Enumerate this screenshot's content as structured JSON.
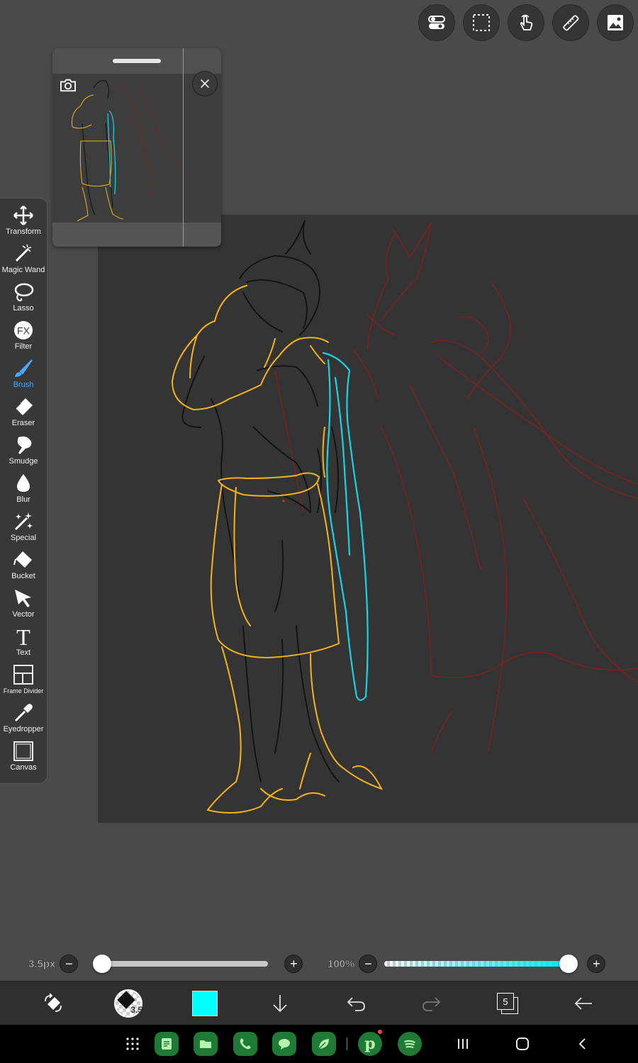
{
  "top_toolbar": {
    "buttons": [
      "toggle-icon",
      "selection-icon",
      "touch-icon",
      "ruler-icon",
      "image-icon"
    ]
  },
  "reference_window": {
    "camera_icon": "camera-icon",
    "close_icon": "close-icon"
  },
  "tools": [
    {
      "label": "Transform",
      "icon": "transform-icon"
    },
    {
      "label": "Magic Wand",
      "icon": "magic-wand-icon"
    },
    {
      "label": "Lasso",
      "icon": "lasso-icon"
    },
    {
      "label": "Filter",
      "icon": "fx-icon"
    },
    {
      "label": "Brush",
      "icon": "brush-icon"
    },
    {
      "label": "Eraser",
      "icon": "eraser-icon"
    },
    {
      "label": "Smudge",
      "icon": "smudge-icon"
    },
    {
      "label": "Blur",
      "icon": "blur-icon"
    },
    {
      "label": "Special",
      "icon": "special-icon"
    },
    {
      "label": "Bucket",
      "icon": "bucket-icon"
    },
    {
      "label": "Vector",
      "icon": "vector-icon"
    },
    {
      "label": "Text",
      "icon": "text-icon"
    },
    {
      "label": "Frame Divider",
      "icon": "frame-divider-icon"
    },
    {
      "label": "Eyedropper",
      "icon": "eyedropper-icon"
    },
    {
      "label": "Canvas",
      "icon": "canvas-icon"
    }
  ],
  "active_tool": "Brush",
  "brush_size": {
    "value_text": "3.5px",
    "level": 0.0
  },
  "opacity": {
    "value_text": "100%",
    "level": 1.0
  },
  "bottom_bar": {
    "brush_size_badge": "3.5",
    "current_color": "#00ffff",
    "layer_count": "5"
  },
  "colors": {
    "accent": "#4aa8ff",
    "line_orange": "#f5b21b",
    "line_cyan": "#19d3e6",
    "line_red": "#8b1c1c"
  },
  "nav_bar": {
    "apps": [
      "apps-grid-icon",
      "notes-app-icon",
      "files-app-icon",
      "phone-app-icon",
      "chat-app-icon",
      "leaf-app-icon",
      "pinterest-icon",
      "spotify-icon"
    ],
    "nav_buttons": [
      "recents-icon",
      "home-icon",
      "back-icon"
    ]
  }
}
